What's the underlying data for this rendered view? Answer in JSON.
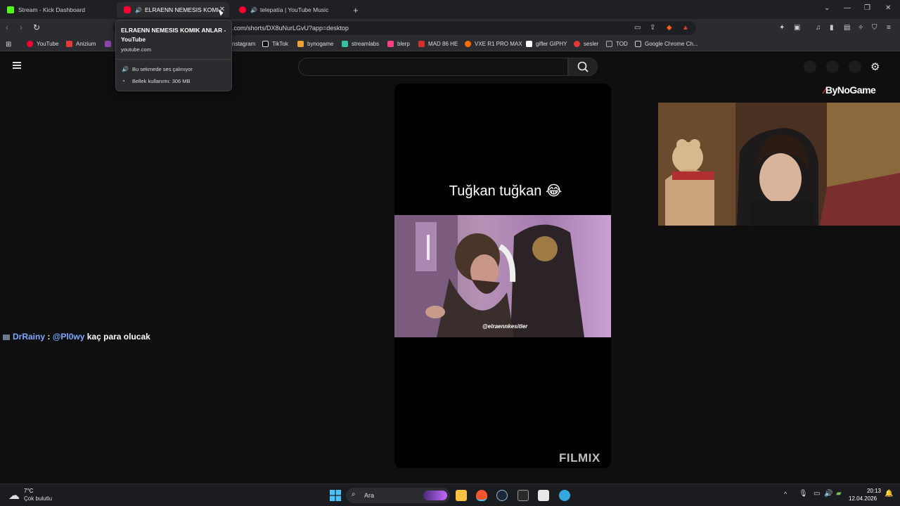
{
  "browser": {
    "tabs": [
      {
        "title": "Stream - Kick Dashboard",
        "favicon": "kick-icon",
        "color": "#53fc18",
        "active": false
      },
      {
        "title": "ELRAENN NEMESIS KOMIK AN",
        "favicon": "youtube-icon",
        "color": "#ff0033",
        "active": true
      },
      {
        "title": "telepatía | YouTube Music",
        "favicon": "youtube-music-icon",
        "color": "#ff0033",
        "active": false
      }
    ],
    "new_tab": "+",
    "url": ".com/shorts/DX8uNurLGvU?app=desktop",
    "bookmarks": [
      {
        "label": "YouTube",
        "color": "#ff0033"
      },
      {
        "label": "Anizium",
        "color": "#e53935"
      },
      {
        "label": "nstagram",
        "color": "#c13584"
      },
      {
        "label": "TikTok",
        "color": "#ffffff"
      },
      {
        "label": "bynogame",
        "color": "#f0a030"
      },
      {
        "label": "streamlabs",
        "color": "#31c3a2"
      },
      {
        "label": "blerp",
        "color": "#ff3d7f"
      },
      {
        "label": "MAD 86 HE",
        "color": "#d32f2f"
      },
      {
        "label": "VXE R1 PRO MAX",
        "color": "#ff6d00"
      },
      {
        "label": "gifler GIPHY",
        "color": "#ffffff"
      },
      {
        "label": "sesler",
        "color": "#e53935"
      },
      {
        "label": "TOD",
        "color": "#ffffff"
      },
      {
        "label": "Google Chrome Ch...",
        "color": "#dddddd"
      }
    ]
  },
  "tooltip": {
    "title": "ELRAENN NEMESIS KOMIK ANLAR - YouTube",
    "domain": "youtube.com",
    "audio_status": "Bu sekmede ses çalınıyor",
    "memory": "Bellek kullanımı: 306 MB"
  },
  "short": {
    "caption": "Tuğkan tuğkan 😂",
    "watermark": "@elraennkesitler",
    "brand": "FILMIX"
  },
  "overlay": {
    "sponsor": "ByNoGame",
    "chat": {
      "user": "DrRainy",
      "sep": " : ",
      "mention": "@Pl0wy",
      "message": " kaç para olucak"
    }
  },
  "taskbar": {
    "temp": "7°C",
    "weather": "Çok bulutlu",
    "search": "Ara",
    "time": "20:13",
    "date": "12.04.2026"
  }
}
